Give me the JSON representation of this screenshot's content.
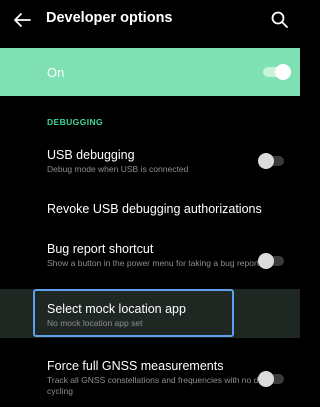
{
  "header": {
    "title": "Developer options",
    "back_icon": "arrow-left-icon",
    "search_icon": "search-icon"
  },
  "master_switch": {
    "label": "On",
    "checked": true,
    "color": "#7fe0b3"
  },
  "section": {
    "header": "DEBUGGING",
    "accent_color": "#3fd99a"
  },
  "preferences": [
    {
      "title": "USB debugging",
      "summary": "Debug mode when USB is connected",
      "checked": false
    },
    {
      "title": "Revoke USB debugging authorizations"
    },
    {
      "title": "Bug report shortcut",
      "summary": "Show a button in the power menu for taking a bug report",
      "checked": false
    },
    {
      "title": "Select mock location app",
      "summary": "No mock location app set",
      "highlighted": true,
      "highlight_color": "#5ea0ea"
    },
    {
      "title": "Force full GNSS measurements",
      "summary": "Track all GNSS constellations and frequencies with no duty cycling",
      "checked": false
    }
  ]
}
